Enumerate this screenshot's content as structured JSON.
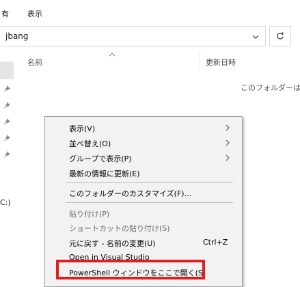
{
  "ribbon": {
    "tabs": [
      "有",
      "表示"
    ]
  },
  "address": {
    "path": "jbang"
  },
  "icons": {
    "dropdown": "chevron-down-icon",
    "refresh": "refresh-icon",
    "pin": "pin-icon",
    "sort": "sort-up-icon",
    "submenu": "chevron-right-icon"
  },
  "nav": {
    "drive_fragment": "C:)"
  },
  "columns": {
    "name": "名前",
    "modified": "更新日時"
  },
  "content": {
    "empty_message": "このフォルダーは空"
  },
  "context_menu": {
    "items": [
      {
        "label": "表示(V)",
        "submenu": true
      },
      {
        "label": "並べ替え(O)",
        "submenu": true
      },
      {
        "label": "グループで表示(P)",
        "submenu": true
      },
      {
        "label": "最新の情報に更新(E)"
      },
      {
        "label": "このフォルダーのカスタマイズ(F)..."
      },
      {
        "label": "貼り付け(P)",
        "disabled": true
      },
      {
        "label": "ショートカットの貼り付け(S)",
        "disabled": true
      },
      {
        "label": "元に戻す - 名前の変更(U)",
        "shortcut": "Ctrl+Z"
      },
      {
        "label": "Open in Visual Studio"
      },
      {
        "label": "PowerShell ウィンドウをここで開く(S)"
      }
    ]
  },
  "colors": {
    "highlight_border": "#e02020",
    "menu_background": "#f2f2f2"
  }
}
